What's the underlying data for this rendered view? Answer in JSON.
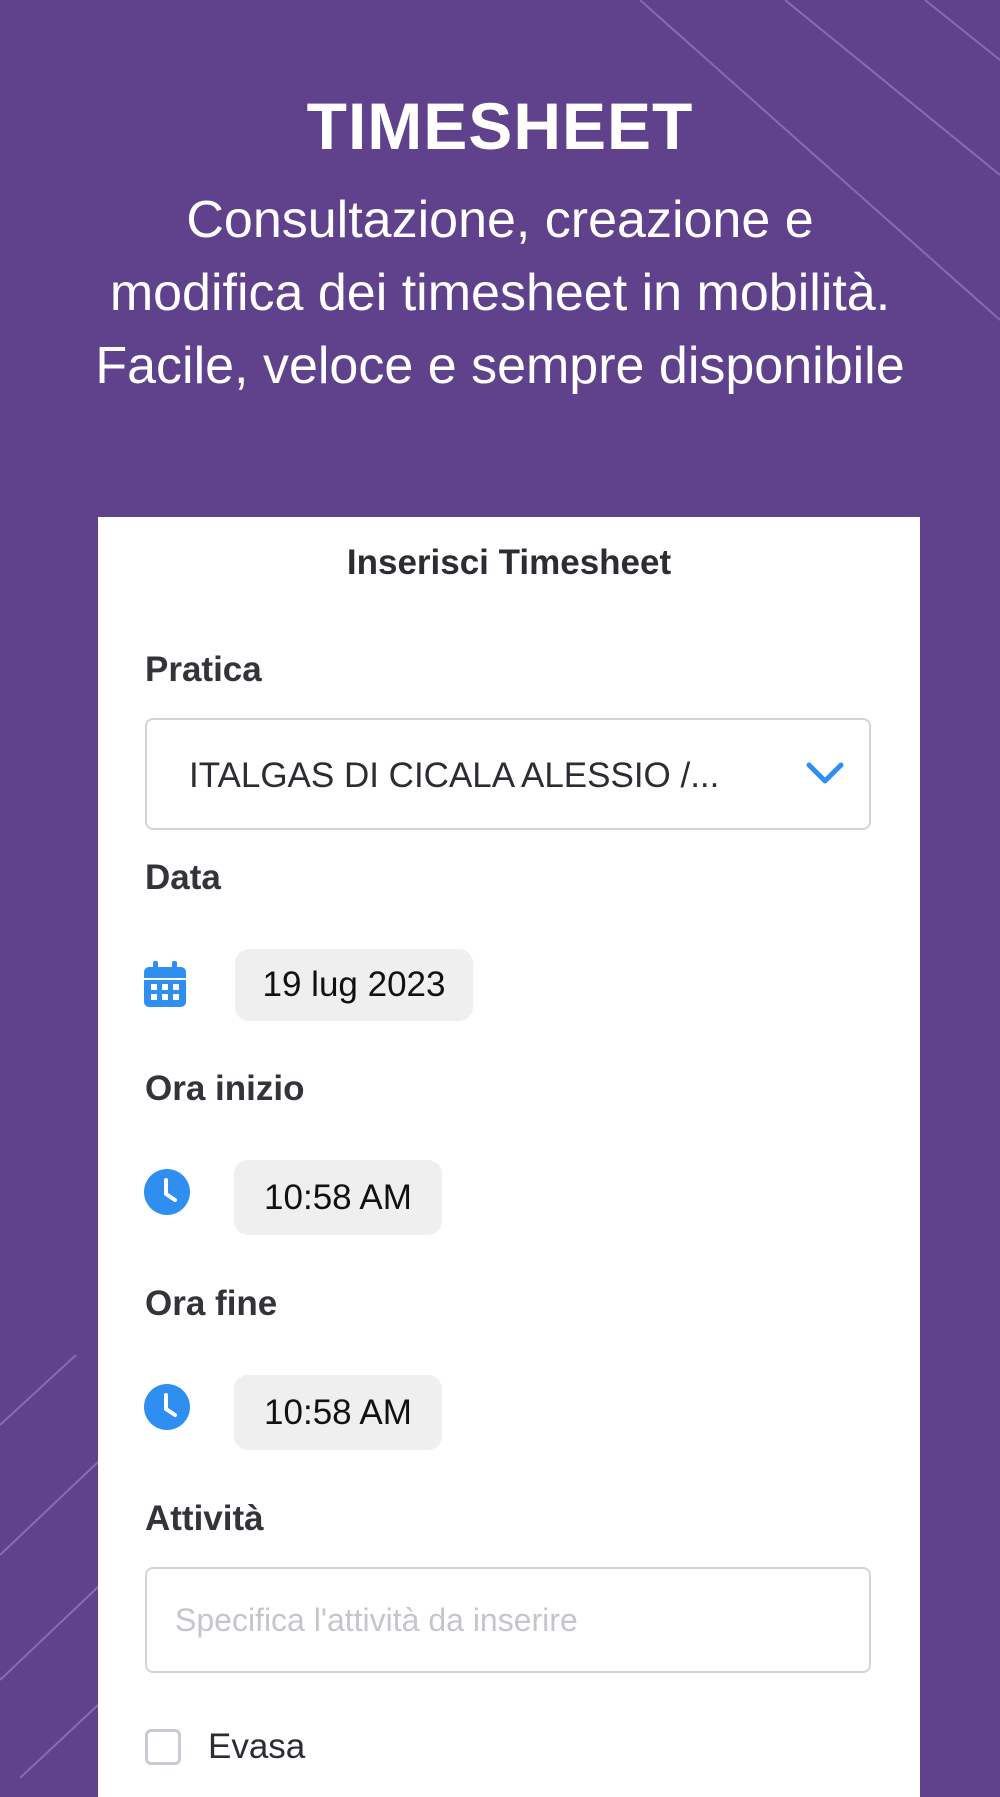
{
  "hero": {
    "title": "TIMESHEET",
    "subtitle_lines": [
      "Consultazione, creazione e",
      "modifica dei timesheet in mobilità.",
      "Facile, veloce e sempre disponibile"
    ]
  },
  "form": {
    "title": "Inserisci Timesheet",
    "pratica": {
      "label": "Pratica",
      "value": "ITALGAS DI CICALA ALESSIO /...",
      "icon": "chevron-down-icon"
    },
    "data": {
      "label": "Data",
      "value": "19 lug 2023",
      "icon": "calendar-icon"
    },
    "ora_inizio": {
      "label": "Ora inizio",
      "value": "10:58 AM",
      "icon": "clock-icon"
    },
    "ora_fine": {
      "label": "Ora fine",
      "value": "10:58 AM",
      "icon": "clock-icon"
    },
    "attivita": {
      "label": "Attività",
      "value": "",
      "placeholder": "Specifica l'attività da inserire"
    },
    "evasa": {
      "label": "Evasa",
      "checked": false
    }
  },
  "colors": {
    "background": "#5f418c",
    "card": "#ffffff",
    "accent": "#2e8ff0",
    "pill": "#efefef",
    "text": "#2c2c33"
  }
}
